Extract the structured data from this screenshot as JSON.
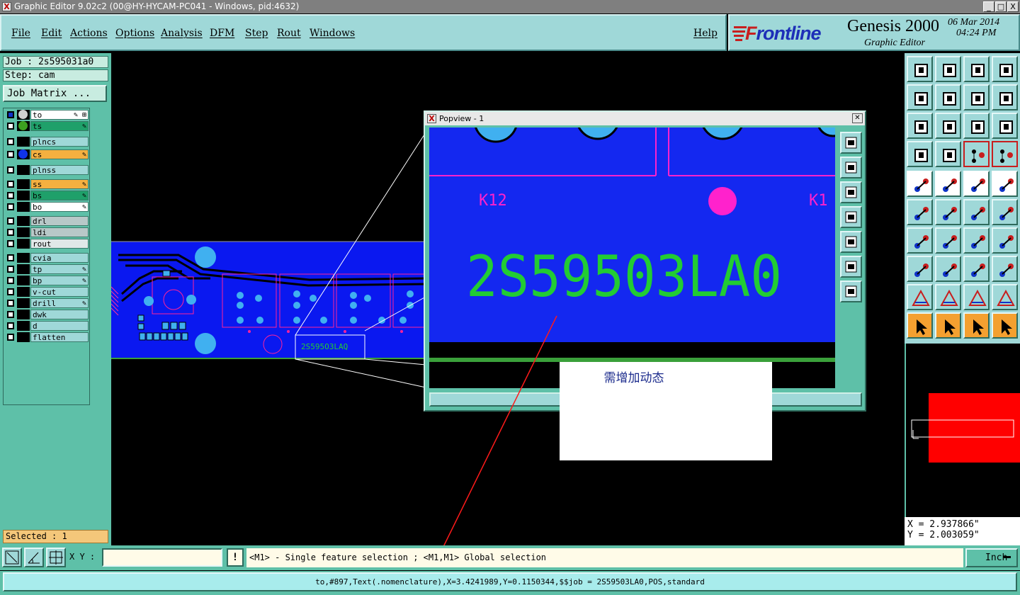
{
  "window": {
    "title": "Graphic Editor 9.02c2 (00@HY-HYCAM-PC041 - Windows, pid:4632)",
    "controls": [
      "_",
      "□",
      "X"
    ]
  },
  "menu": {
    "file": "File",
    "edit": "Edit",
    "actions": "Actions",
    "options": "Options",
    "analysis": "Analysis",
    "dfm": "DFM",
    "step": "Step",
    "rout": "Rout",
    "windows": "Windows",
    "help": "Help"
  },
  "brand": {
    "logo_f": "F",
    "logo_rest": "rontline",
    "product": "Genesis 2000",
    "subtitle": "Graphic Editor",
    "date": "06 Mar 2014",
    "time": "04:24 PM"
  },
  "job": {
    "job_label": "Job : 2s595031a0",
    "step_label": "Step: cam",
    "matrix_button": "Job Matrix ..."
  },
  "layers": [
    {
      "name": "to",
      "color": "#ffffff",
      "dot": "#d0d0d0",
      "checked": true,
      "flag": "✎ ⊞"
    },
    {
      "name": "ts",
      "color": "#1fa06a",
      "dot": "#3ca020",
      "checked": false,
      "flag": "✎"
    },
    {
      "name": "plncs",
      "color": "#9fd8d8",
      "dot": "",
      "checked": false,
      "flag": ""
    },
    {
      "name": "cs",
      "color": "#f4b040",
      "dot": "#1033e8",
      "checked": false,
      "flag": "✎"
    },
    {
      "name": "plnss",
      "color": "#9fd8d8",
      "dot": "",
      "checked": false,
      "flag": ""
    },
    {
      "name": "ss",
      "color": "#f4b040",
      "dot": "",
      "checked": false,
      "flag": "✎"
    },
    {
      "name": "bs",
      "color": "#1fa06a",
      "dot": "",
      "checked": false,
      "flag": "✎"
    },
    {
      "name": "bo",
      "color": "#ffffff",
      "dot": "",
      "checked": false,
      "flag": "✎"
    },
    {
      "name": "drl",
      "color": "#b8c8c8",
      "dot": "",
      "checked": false,
      "flag": ""
    },
    {
      "name": "ldi",
      "color": "#b8c8c8",
      "dot": "",
      "checked": false,
      "flag": ""
    },
    {
      "name": "rout",
      "color": "#e0e8e8",
      "dot": "",
      "checked": false,
      "flag": ""
    },
    {
      "name": "cvia",
      "color": "#9fd8d8",
      "dot": "",
      "checked": false,
      "flag": ""
    },
    {
      "name": "tp",
      "color": "#9fd8d8",
      "dot": "",
      "checked": false,
      "flag": "✎"
    },
    {
      "name": "bp",
      "color": "#9fd8d8",
      "dot": "",
      "checked": false,
      "flag": "✎"
    },
    {
      "name": "v-cut",
      "color": "#9fd8d8",
      "dot": "",
      "checked": false,
      "flag": ""
    },
    {
      "name": "drill",
      "color": "#9fd8d8",
      "dot": "",
      "checked": false,
      "flag": "✎"
    },
    {
      "name": "dwk",
      "color": "#9fd8d8",
      "dot": "",
      "checked": false,
      "flag": ""
    },
    {
      "name": "d",
      "color": "#9fd8d8",
      "dot": "",
      "checked": false,
      "flag": ""
    },
    {
      "name": "flatten",
      "color": "#9fd8d8",
      "dot": "",
      "checked": false,
      "flag": ""
    }
  ],
  "selected": "Selected : 1",
  "popview": {
    "title": "Popview - 1",
    "close": "✕",
    "labels": {
      "k12": "K12",
      "k13": "K1",
      "big_text": "2S59503LA0"
    }
  },
  "board": {
    "nomen_text": "2S595O3LAQ"
  },
  "annotation": {
    "text": "需增加动态"
  },
  "coords": {
    "x": "X = 2.937866\"",
    "y": "Y = 2.003059\""
  },
  "cmd": {
    "xy_label": "X Y :",
    "xy_value": "",
    "bang": "!",
    "hint": "<M1> - Single feature selection ; <M1,M1> Global selection",
    "unit": "Inch"
  },
  "status": "to,#897,Text(.nomenclature),X=3.4241989,Y=0.1150344,$$job = 2S59503LA0,POS,standard",
  "colors": {
    "board_blue": "#0a18f0",
    "popview_blue": "#1428f0",
    "text_green": "#22cc33",
    "magenta": "#ff22cc",
    "pad_cyan": "#40b0f0",
    "accent_red": "#ff0000"
  }
}
